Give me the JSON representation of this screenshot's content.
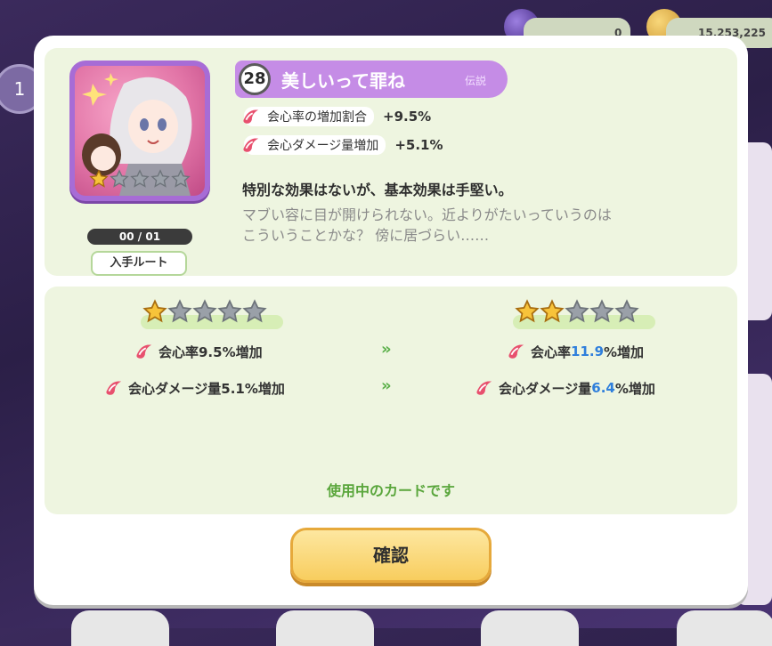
{
  "background": {
    "hud": {
      "gem_count": "0",
      "coin_count": "15,253,225"
    },
    "left_badge": "1"
  },
  "modal": {
    "card": {
      "level": "28",
      "title": "美しいって罪ね",
      "rarity": "伝説",
      "star_rating": 1,
      "max_stars": 5,
      "count": "00 / 01",
      "route_button": "入手ルート",
      "stats": [
        {
          "icon": "crit-drop-icon",
          "label": "会心率の増加割合",
          "value": "+9.5%"
        },
        {
          "icon": "crit-drop-icon",
          "label": "会心ダメージ量増加",
          "value": "+5.1%"
        }
      ],
      "effect_text": "特別な効果はないが、基本効果は手堅い。",
      "flavor_line1": "マブい容に目が開けられない。近よりがたいっていうのは",
      "flavor_line2": "こういうことかな？ 傍に居づらい……"
    },
    "comparison": {
      "current": {
        "stars": 1,
        "line1": {
          "pre": "会心率9.5%増加"
        },
        "line2": {
          "pre": "会心ダメージ量5.1%増加"
        }
      },
      "next": {
        "stars": 2,
        "line1": {
          "pre": "会心率",
          "hl": "11.9",
          "post": "%増加"
        },
        "line2": {
          "pre": "会心ダメージ量",
          "hl": "6.4",
          "post": "%増加"
        }
      },
      "arrow": "»",
      "in_use_text": "使用中のカードです"
    },
    "confirm_button": "確認",
    "close_symbol": "✕"
  }
}
